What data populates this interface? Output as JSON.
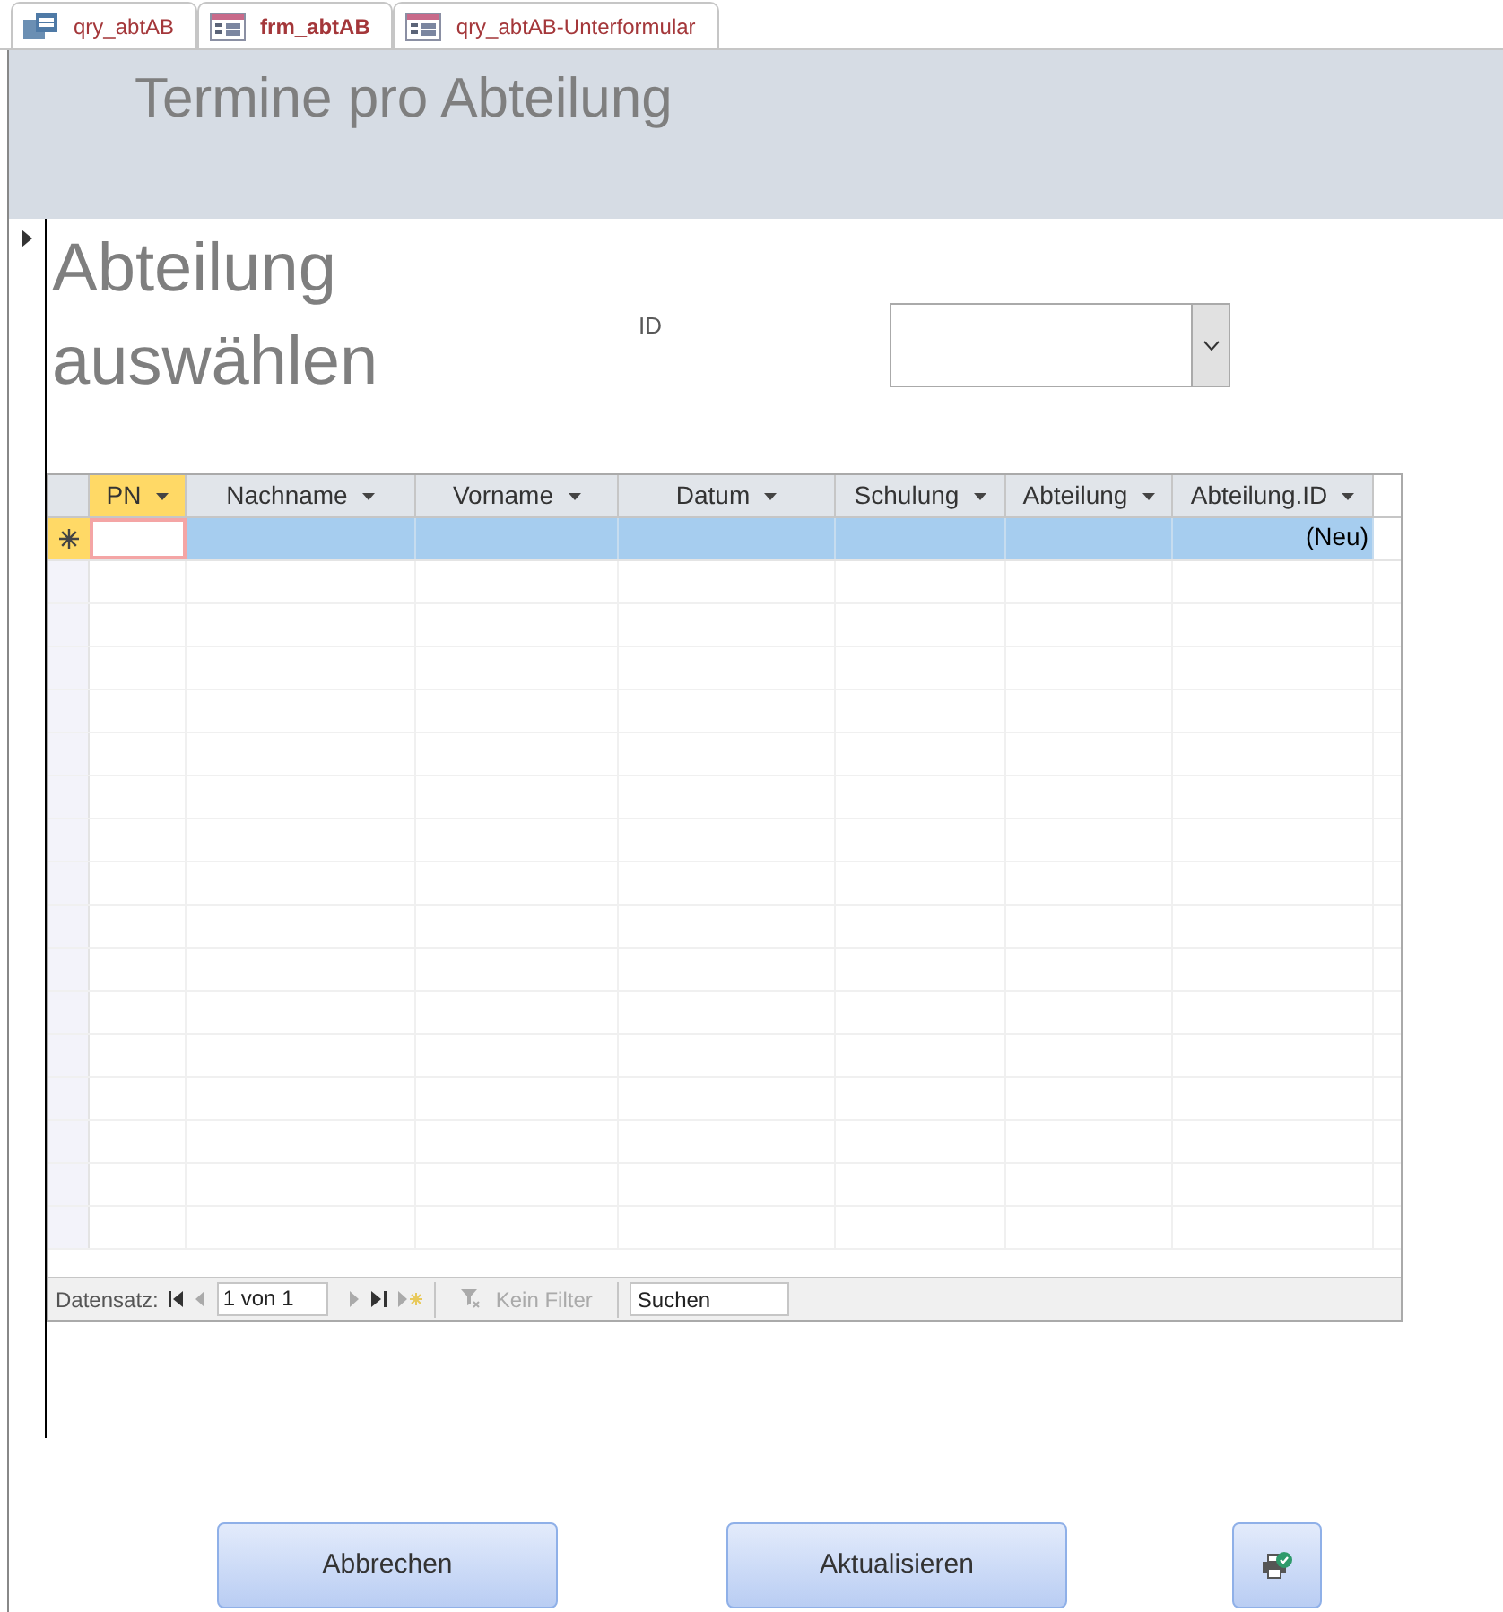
{
  "tabs": [
    {
      "label": "qry_abtAB",
      "kind": "query",
      "selected": false
    },
    {
      "label": "frm_abtAB",
      "kind": "form",
      "selected": true
    },
    {
      "label": "qry_abtAB-Unterformular",
      "kind": "form",
      "selected": false
    }
  ],
  "form_header": {
    "title": "Termine pro Abteilung"
  },
  "form": {
    "heading": "Abteilung auswählen",
    "combo_label": "ID"
  },
  "datasheet": {
    "columns": [
      {
        "label": "PN",
        "selected": true
      },
      {
        "label": "Nachname",
        "selected": false
      },
      {
        "label": "Vorname",
        "selected": false
      },
      {
        "label": "Datum",
        "selected": false
      },
      {
        "label": "Schulung",
        "selected": false
      },
      {
        "label": "Abteilung",
        "selected": false
      },
      {
        "label": "Abteilung.ID",
        "selected": false
      }
    ],
    "new_row": {
      "id_placeholder": "(Neu)"
    },
    "navigation": {
      "label": "Datensatz:",
      "position": "1 von 1",
      "filter": "Kein Filter",
      "search_placeholder": "Suchen"
    }
  },
  "buttons": [
    {
      "label": "Abbrechen",
      "kind": "text"
    },
    {
      "label": "Aktualisieren",
      "kind": "text"
    },
    {
      "kind": "icon"
    }
  ]
}
